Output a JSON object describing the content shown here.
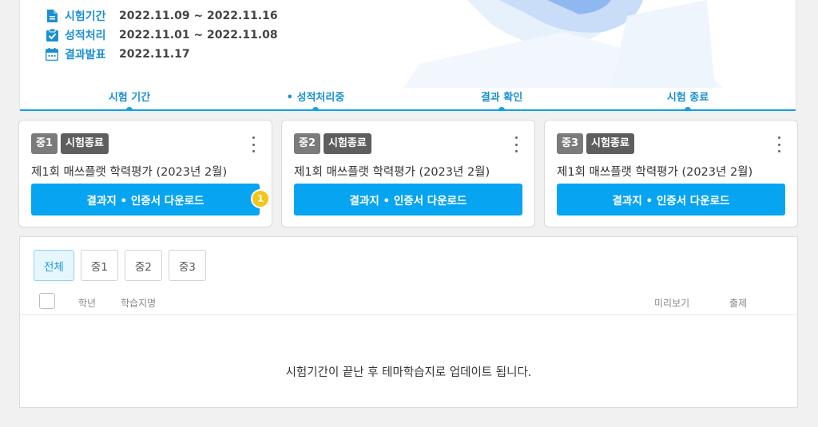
{
  "schedule": {
    "rows": [
      {
        "icon": "document-icon",
        "label": "시험기간",
        "value": "2022.11.09 ~ 2022.11.16"
      },
      {
        "icon": "clipboard-check-icon",
        "label": "성적처리",
        "value": "2022.11.01 ~ 2022.11.08"
      },
      {
        "icon": "calendar-icon",
        "label": "결과발표",
        "value": "2022.11.17"
      }
    ]
  },
  "steps": [
    "시험 기간",
    "• 성적처리중",
    "결과 확인",
    "시험 종료"
  ],
  "cards": [
    {
      "grade": "중1",
      "status": "시험종료",
      "title": "제1회 매쓰플랫 학력평가 (2023년 2월)",
      "button": "결과지 • 인증서 다운로드",
      "badge": "1"
    },
    {
      "grade": "중2",
      "status": "시험종료",
      "title": "제1회 매쓰플랫 학력평가 (2023년 2월)",
      "button": "결과지 • 인증서 다운로드"
    },
    {
      "grade": "중3",
      "status": "시험종료",
      "title": "제1회 매쓰플랫 학력평가 (2023년 2월)",
      "button": "결과지 • 인증서 다운로드"
    }
  ],
  "filters": {
    "tabs": [
      "전체",
      "중1",
      "중2",
      "중3"
    ],
    "active": "전체"
  },
  "table": {
    "columns": [
      "학년",
      "학습지명",
      "미리보기",
      "출제"
    ],
    "empty_message": "시험기간이 끝난 후 테마학습지로 업데이트 됩니다."
  },
  "colors": {
    "accent": "#07a4f2",
    "label_blue": "#1b8fd2",
    "badge": "#f5c518"
  }
}
